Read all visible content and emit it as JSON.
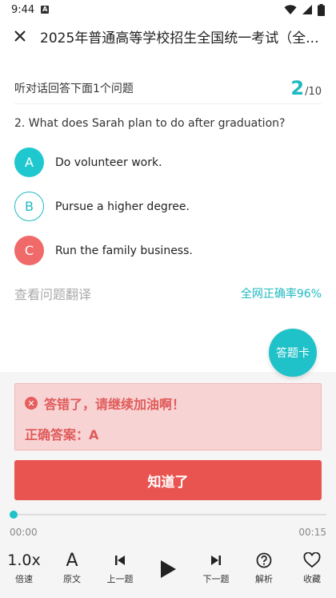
{
  "status": {
    "time": "9:44"
  },
  "header": {
    "title": "2025年普通高等学校招生全国统一考试（全..."
  },
  "question_head": {
    "instruction": "听对话回答下面1个问题",
    "current": "2",
    "total": "/10"
  },
  "question": {
    "text": "2. What does Sarah plan to do after graduation?"
  },
  "options": [
    {
      "letter": "A",
      "text": "Do volunteer work."
    },
    {
      "letter": "B",
      "text": "Pursue a higher degree."
    },
    {
      "letter": "C",
      "text": "Run the family business."
    }
  ],
  "translation": {
    "link": "查看问题翻译",
    "rate": "全网正确率96%"
  },
  "answer_card": {
    "label": "答题卡"
  },
  "feedback": {
    "wrong": "答错了，请继续加油啊！",
    "correct": "正确答案：A"
  },
  "confirm": {
    "label": "知道了"
  },
  "player": {
    "start": "00:00",
    "end": "00:15",
    "progress": 0.0
  },
  "toolbar": {
    "speed_value": "1.0x",
    "speed": "倍速",
    "original": "原文",
    "prev": "上一题",
    "next": "下一题",
    "analysis": "解析",
    "favorite": "收藏"
  },
  "colors": {
    "accent": "#1fc2c8",
    "wrong": "#f06a6a",
    "button": "#e95450"
  }
}
